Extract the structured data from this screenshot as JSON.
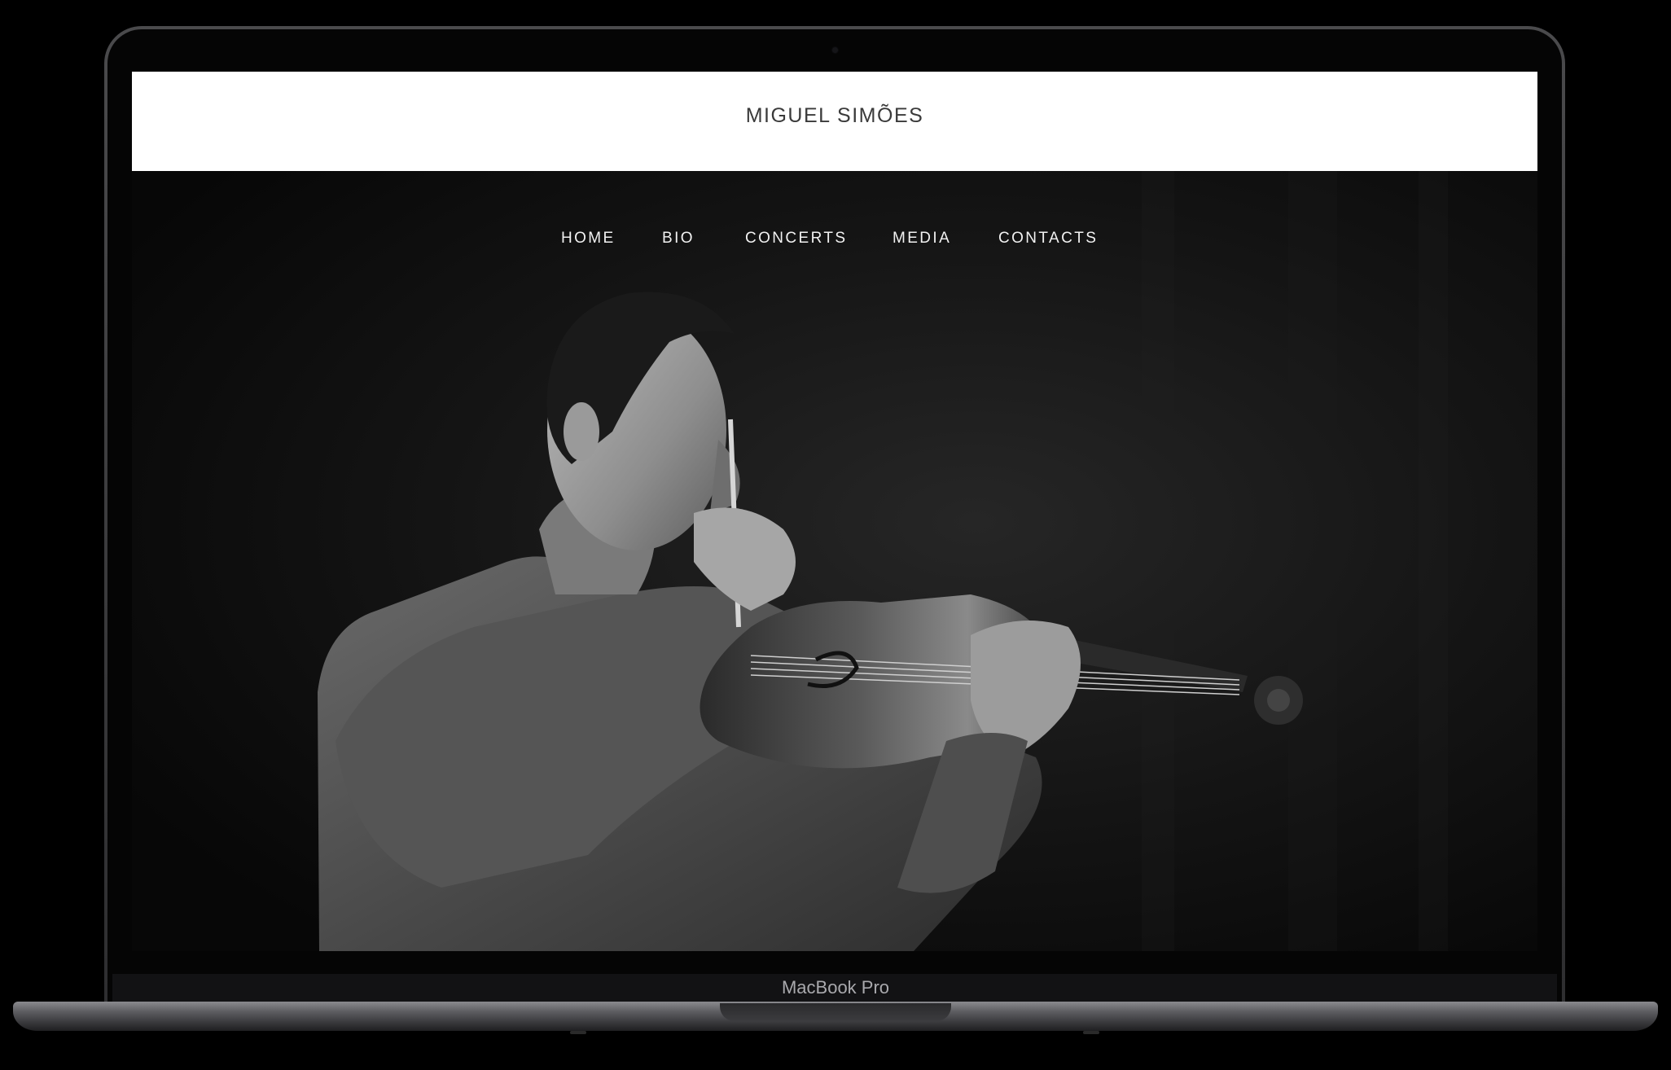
{
  "site": {
    "title": "MIGUEL SIMÕES"
  },
  "nav": {
    "items": [
      {
        "label": "HOME"
      },
      {
        "label": "BIO"
      },
      {
        "label": "CONCERTS"
      },
      {
        "label": "MEDIA"
      },
      {
        "label": "CONTACTS"
      }
    ]
  },
  "device": {
    "label": "MacBook Pro"
  },
  "colors": {
    "header_bg": "#ffffff",
    "title_text": "#3a3a3a",
    "nav_text": "#f2f2f2",
    "hero_bg": "#0d0d0d"
  }
}
